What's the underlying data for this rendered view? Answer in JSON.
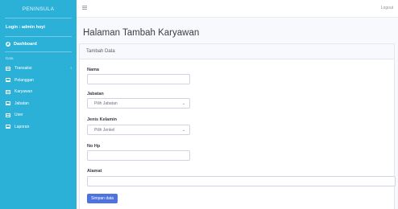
{
  "sidebar": {
    "brand": "PENINSULA",
    "login_text": "Login : admin hoyi",
    "dashboard": "Dashboard",
    "section": "Data",
    "items": [
      {
        "label": "Transaksi",
        "has_chevron": true
      },
      {
        "label": "Pelanggan"
      },
      {
        "label": "Karyawan"
      },
      {
        "label": "Jabatan"
      },
      {
        "label": "User"
      },
      {
        "label": "Laporan"
      }
    ]
  },
  "topbar": {
    "logout": "Logout"
  },
  "page": {
    "title": "Halaman Tambah Karyawan"
  },
  "card": {
    "header": "Tambah Data",
    "fields": {
      "nama": {
        "label": "Nama",
        "value": ""
      },
      "jabatan": {
        "label": "Jabatan",
        "selected": "Pilih Jabatan"
      },
      "jenis_kelamin": {
        "label": "Jenis Kelamin",
        "selected": "Pilih Jenkel"
      },
      "no_hp": {
        "label": "No Hp",
        "value": ""
      },
      "alamat": {
        "label": "Alamat",
        "value": ""
      }
    },
    "submit": "Simpan data"
  },
  "colors": {
    "sidebar": "#2bb0d8",
    "primary": "#4e73df"
  }
}
